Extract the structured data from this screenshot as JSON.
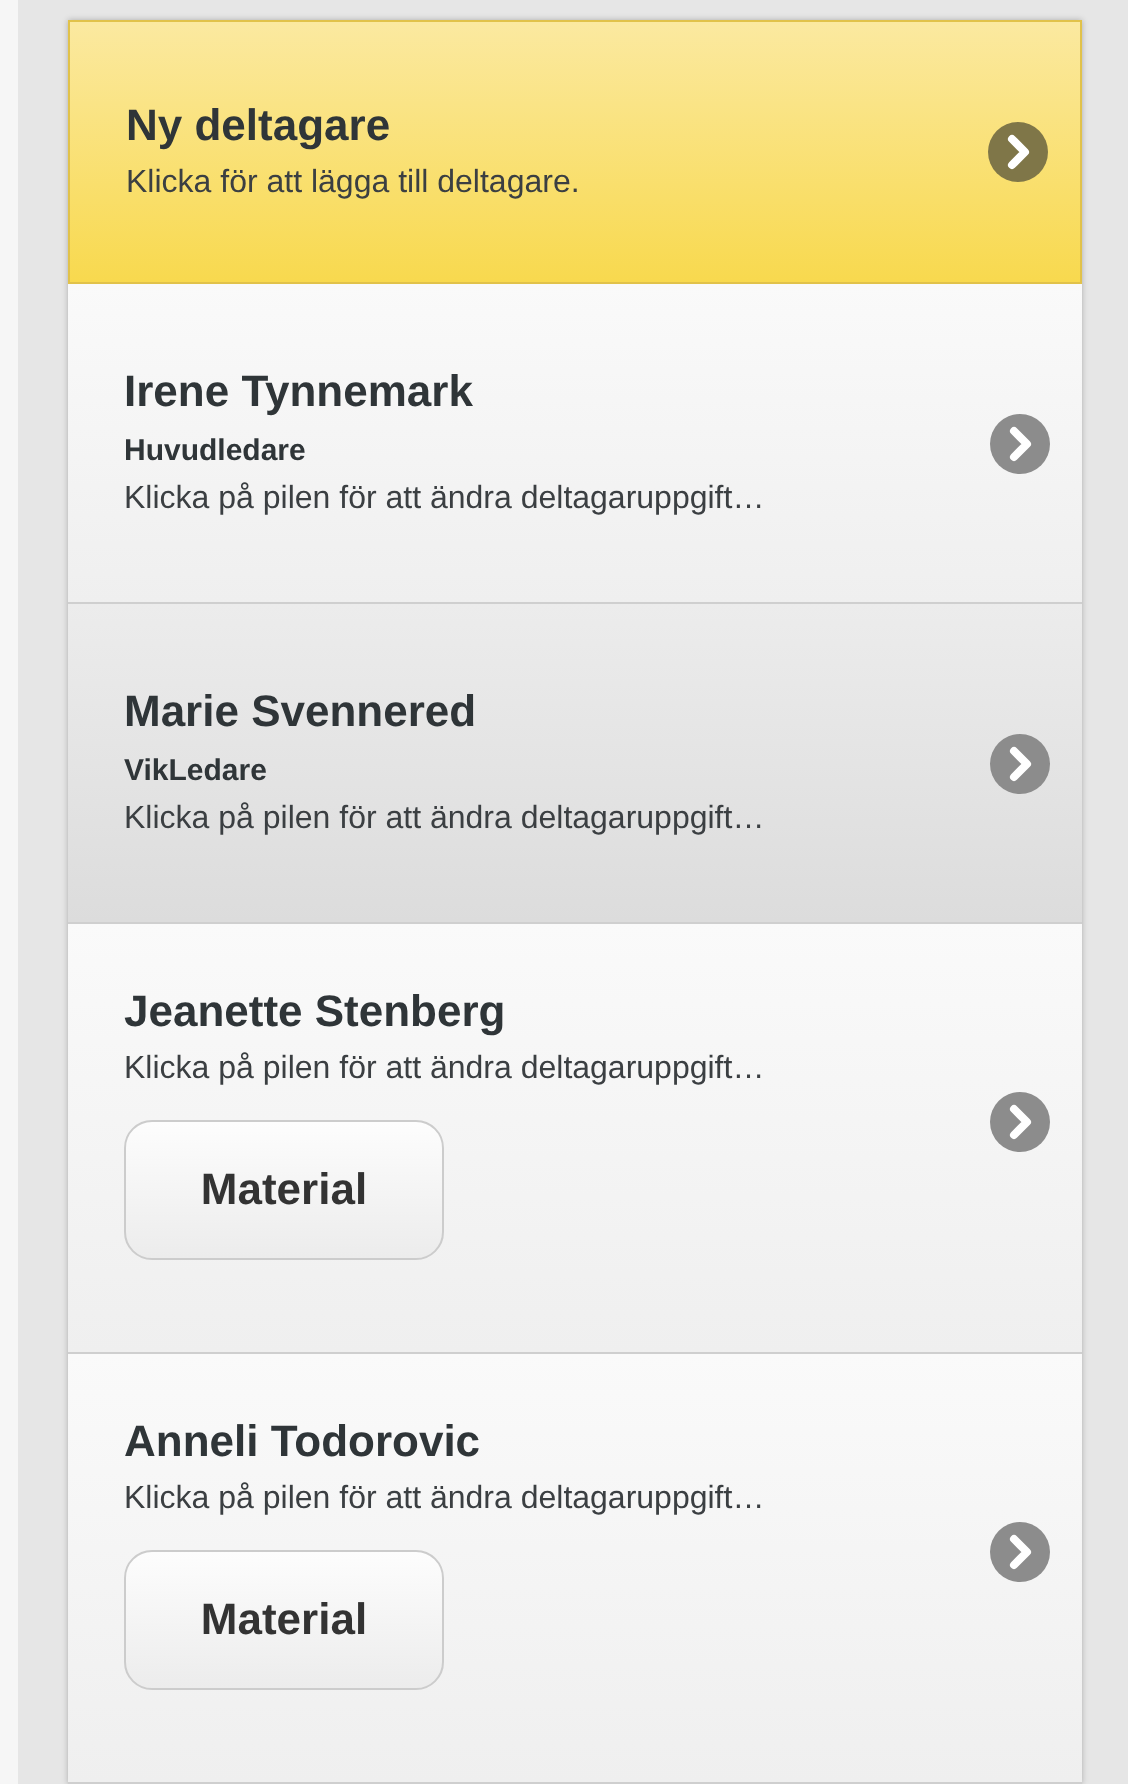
{
  "participants": [
    {
      "kind": "add",
      "name": "Ny deltagare",
      "description": "Klicka för att lägga till deltagare.",
      "selected": false
    },
    {
      "kind": "person",
      "name": "Irene Tynnemark",
      "role": "Huvudledare",
      "description": "Klicka på pilen för att ändra deltagaruppgift…",
      "selected": false
    },
    {
      "kind": "person",
      "name": "Marie Svennered",
      "role": "VikLedare",
      "description": "Klicka på pilen för att ändra deltagaruppgift…",
      "selected": true
    },
    {
      "kind": "person",
      "name": "Jeanette Stenberg",
      "description": "Klicka på pilen för att ändra deltagaruppgift…",
      "button": "Material",
      "selected": false
    },
    {
      "kind": "person",
      "name": "Anneli Todorovic",
      "description": "Klicka på pilen för att ändra deltagaruppgift…",
      "button": "Material",
      "selected": false
    }
  ]
}
